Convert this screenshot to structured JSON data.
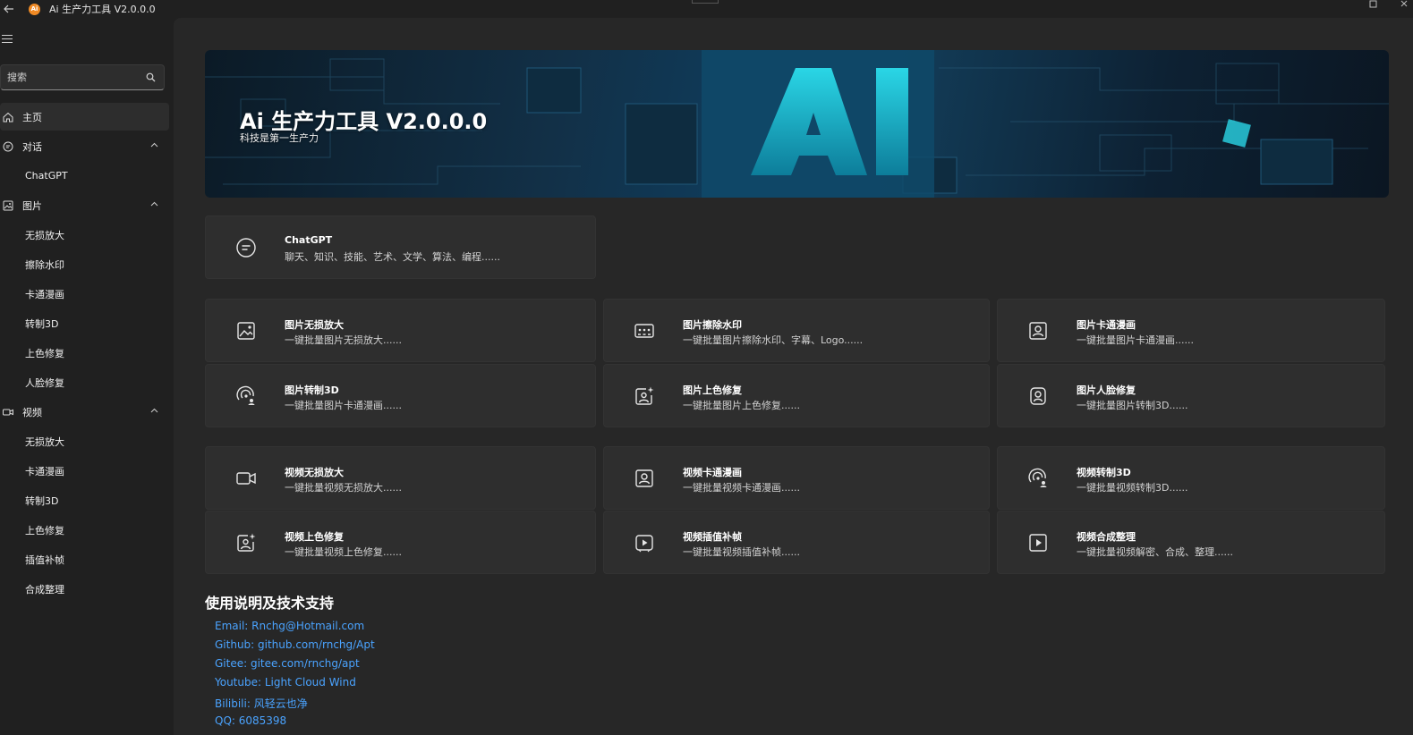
{
  "window": {
    "title": "Ai 生产力工具 V2.0.0.0",
    "logo_text": "Ai"
  },
  "sidebar": {
    "search_placeholder": "搜索",
    "items": [
      {
        "label": "主页",
        "icon": "home-icon",
        "active": true
      },
      {
        "label": "对话",
        "icon": "chat-icon",
        "expanded": true,
        "children": [
          "ChatGPT"
        ]
      },
      {
        "label": "图片",
        "icon": "image-icon",
        "expanded": true,
        "children": [
          "无损放大",
          "擦除水印",
          "卡通漫画",
          "转制3D",
          "上色修复",
          "人脸修复"
        ]
      },
      {
        "label": "视频",
        "icon": "video-icon",
        "expanded": true,
        "children": [
          "无损放大",
          "卡通漫画",
          "转制3D",
          "上色修复",
          "插值补帧",
          "合成整理"
        ]
      }
    ]
  },
  "banner": {
    "title": "Ai 生产力工具 V2.0.0.0",
    "subtitle": "科技是第一生产力",
    "overlay_text": "AI"
  },
  "cards": {
    "chatgpt": {
      "title": "ChatGPT",
      "desc": "聊天、知识、技能、艺术、文学、算法、编程......",
      "icon": "chat-icon"
    },
    "image": [
      {
        "title": "图片无损放大",
        "desc": "一键批量图片无损放大......",
        "icon": "image-icon"
      },
      {
        "title": "图片擦除水印",
        "desc": "一键批量图片擦除水印、字幕、Logo......",
        "icon": "image-multiple-icon"
      },
      {
        "title": "图片卡通漫画",
        "desc": "一键批量图片卡通漫画......",
        "icon": "person-square-icon"
      },
      {
        "title": "图片转制3D",
        "desc": "一键批量图片卡通漫画......",
        "icon": "radar-person-icon"
      },
      {
        "title": "图片上色修复",
        "desc": "一键批量图片上色修复......",
        "icon": "image-sparkle-icon"
      },
      {
        "title": "图片人脸修复",
        "desc": "一键批量图片转制3D......",
        "icon": "face-scan-icon"
      }
    ],
    "video": [
      {
        "title": "视频无损放大",
        "desc": "一键批量视频无损放大......",
        "icon": "video-camera-icon"
      },
      {
        "title": "视频卡通漫画",
        "desc": "一键批量视频卡通漫画......",
        "icon": "person-square-icon"
      },
      {
        "title": "视频转制3D",
        "desc": "一键批量视频转制3D......",
        "icon": "radar-person-icon"
      },
      {
        "title": "视频上色修复",
        "desc": "一键批量视频上色修复......",
        "icon": "image-sparkle-icon"
      },
      {
        "title": "视频插值补帧",
        "desc": "一键批量视频插值补帧......",
        "icon": "play-frame-icon"
      },
      {
        "title": "视频合成整理",
        "desc": "一键批量视频解密、合成、整理......",
        "icon": "play-square-icon"
      }
    ]
  },
  "support": {
    "title": "使用说明及技术支持",
    "links": [
      "Email: Rnchg@Hotmail.com",
      "Github: github.com/rnchg/Apt",
      "Gitee: gitee.com/rnchg/apt",
      "Youtube: Light Cloud Wind",
      "Bilibili: 风轻云也净",
      "QQ: 6085398"
    ]
  },
  "colors": {
    "background": "#202020",
    "main": "#272727",
    "card": "#2e2e2e",
    "link": "#4aa3ff",
    "accent": "#f08a24"
  }
}
